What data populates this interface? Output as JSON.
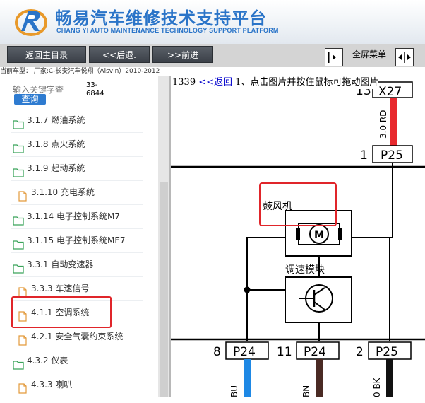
{
  "header": {
    "title_cn": "畅易汽车维修技术支持平台",
    "title_en": "CHANG YI AUTO MAINTENANCE TECHNOLOGY SUPPORT PLATFORM",
    "brand_color": "#2a74c8"
  },
  "toolbar": {
    "home_label": "返回主目录",
    "back_label": "<<后退.",
    "forward_label": ">>前进",
    "fullscreen_label": "全屏菜单"
  },
  "car_info": "当前车型： 厂家:C-长安汽车悦翔（Alsvin）2010-2012",
  "search": {
    "placeholder": "输入关键字查",
    "button_label": "查询",
    "count": "33-6844"
  },
  "tree": [
    {
      "type": "folder",
      "label": "3.1.7 燃油系统"
    },
    {
      "type": "folder",
      "label": "3.1.8 点火系统"
    },
    {
      "type": "folder",
      "label": "3.1.9 起动系统"
    },
    {
      "type": "file",
      "label": "3.1.10 充电系统"
    },
    {
      "type": "folder",
      "label": "3.1.14 电子控制系统M7"
    },
    {
      "type": "folder",
      "label": "3.1.15 电子控制系统ME7"
    },
    {
      "type": "folder",
      "label": "3.3.1 自动变速器"
    },
    {
      "type": "file",
      "label": "3.3.3 车速信号"
    },
    {
      "type": "file",
      "label": "4.1.1 空调系统",
      "highlighted": true
    },
    {
      "type": "file",
      "label": "4.2.1 安全气囊约束系统"
    },
    {
      "type": "folder",
      "label": "4.3.2 仪表"
    },
    {
      "type": "file",
      "label": "4.3.3 喇叭"
    }
  ],
  "content": {
    "page_number": "1339",
    "back_link": "<<返回",
    "instruction": " 1、点击图片并按住鼠标可拖动图片"
  },
  "diagram": {
    "top_connector": "X27",
    "top_pin": "13",
    "top_wire_label": "3.0 RD",
    "p25_top_pin": "1",
    "p25_top_label": "P25",
    "blower_label": "鼓风机",
    "motor_symbol": "M",
    "speed_module_label": "调速模块",
    "bottom_connectors": [
      {
        "pin": "8",
        "label": "P24"
      },
      {
        "pin": "11",
        "label": "P24"
      },
      {
        "pin": "2",
        "label": "P25"
      }
    ],
    "bottom_wire_labels": [
      "BU",
      "BN",
      "0 BK"
    ],
    "colors": {
      "red_wire": "#e8292e",
      "blue_wire": "#1e88e5",
      "brown_wire": "#4a2a24",
      "black_wire": "#111111",
      "highlight": "#e0252a"
    }
  }
}
